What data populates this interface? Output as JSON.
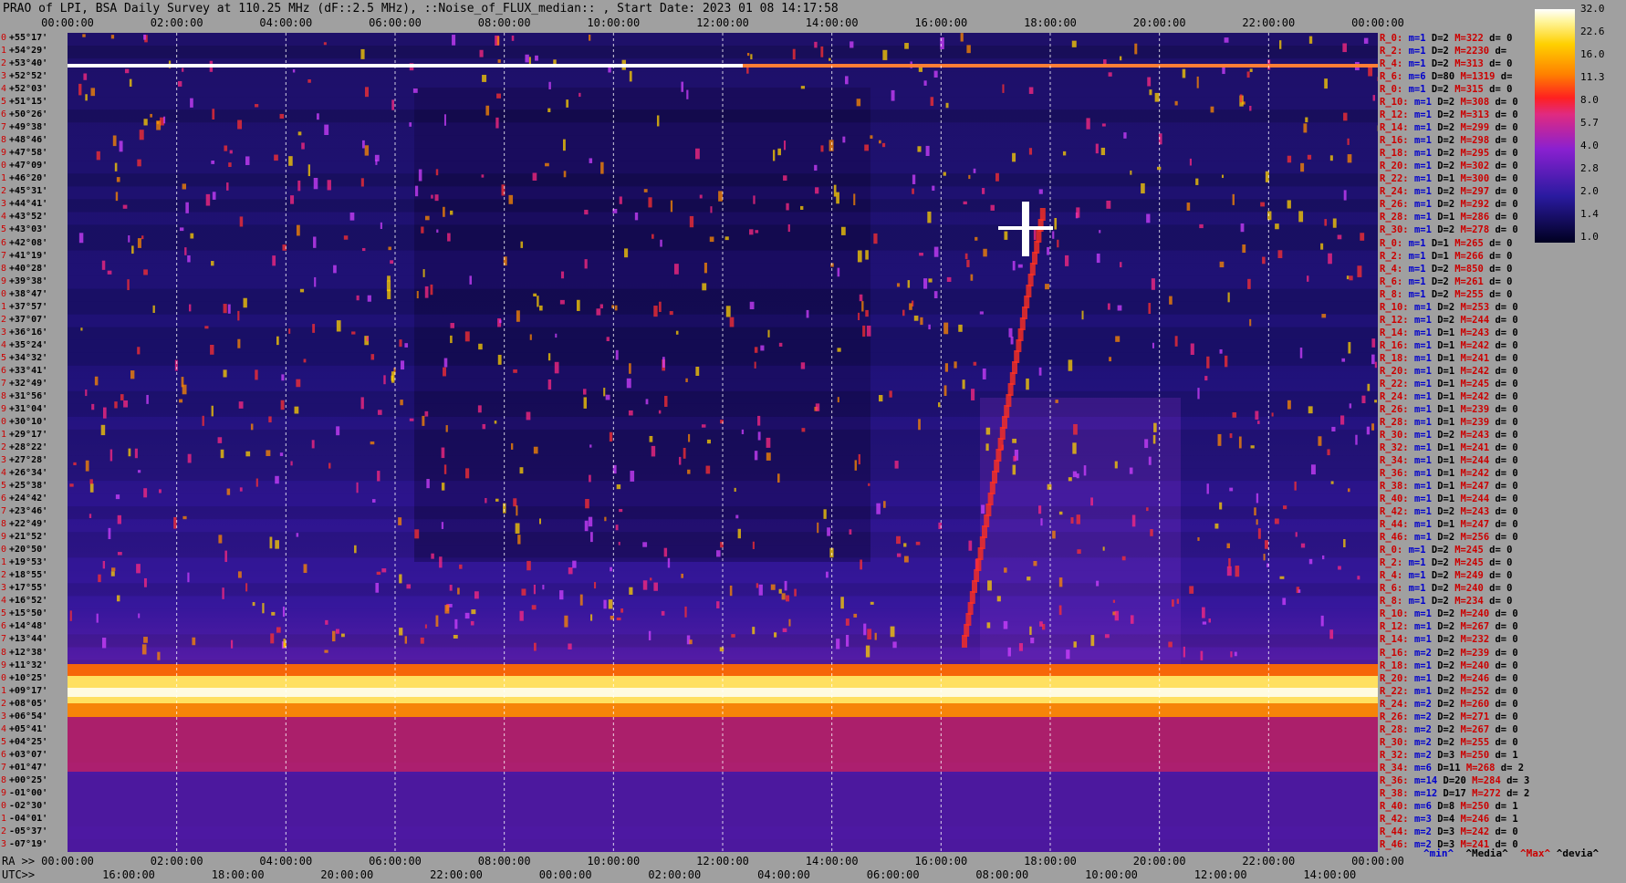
{
  "title": "PRAO of LPI, BSA Daily Survey at 110.25 MHz (dF::2.5 MHz), ::Noise_of_FLUX_median:: , Start Date: 2023 01 08 14:17:58",
  "top_axis_ticks": [
    "00:00:00",
    "02:00:00",
    "04:00:00",
    "06:00:00",
    "08:00:00",
    "10:00:00",
    "12:00:00",
    "14:00:00",
    "16:00:00",
    "18:00:00",
    "20:00:00",
    "22:00:00",
    "00:00:00"
  ],
  "ra_axis": {
    "prefix": "RA >>",
    "ticks": [
      "00:00:00",
      "02:00:00",
      "04:00:00",
      "06:00:00",
      "08:00:00",
      "10:00:00",
      "12:00:00",
      "14:00:00",
      "16:00:00",
      "18:00:00",
      "20:00:00",
      "22:00:00",
      "00:00:00"
    ]
  },
  "utc_axis": {
    "prefix": "UTC>>",
    "ticks": [
      "16:00:00",
      "18:00:00",
      "20:00:00",
      "22:00:00",
      "00:00:00",
      "02:00:00",
      "04:00:00",
      "06:00:00",
      "08:00:00",
      "10:00:00",
      "12:00:00",
      "14:00:00"
    ]
  },
  "declinations": [
    "+55°17'",
    "+54°29'",
    "+53°40'",
    "+52°52'",
    "+52°03'",
    "+51°15'",
    "+50°26'",
    "+49°38'",
    "+48°46'",
    "+47°58'",
    "+47°09'",
    "+46°20'",
    "+45°31'",
    "+44°41'",
    "+43°52'",
    "+43°03'",
    "+42°08'",
    "+41°19'",
    "+40°28'",
    "+39°38'",
    "+38°47'",
    "+37°57'",
    "+37°07'",
    "+36°16'",
    "+35°24'",
    "+34°32'",
    "+33°41'",
    "+32°49'",
    "+31°56'",
    "+31°04'",
    "+30°10'",
    "+29°17'",
    "+28°22'",
    "+27°28'",
    "+26°34'",
    "+25°38'",
    "+24°42'",
    "+23°46'",
    "+22°49'",
    "+21°52'",
    "+20°50'",
    "+19°53'",
    "+18°55'",
    "+17°55'",
    "+16°52'",
    "+15°50'",
    "+14°48'",
    "+13°44'",
    "+12°38'",
    "+11°32'",
    "+10°25'",
    "+09°17'",
    "+08°05'",
    "+06°54'",
    "+05°41'",
    "+04°25'",
    "+03°07'",
    "+01°47'",
    "+00°25'",
    "-01°00'",
    "-02°30'",
    "-04°01'",
    "-05°37'",
    "-07°19'"
  ],
  "stats": [
    {
      "r": "R_0:",
      "m": "m=1",
      "d": "D=2",
      "M": "M=322",
      "dv": "d= 0"
    },
    {
      "r": "R_2:",
      "m": "m=1",
      "d": "D=2",
      "M": "M=2230",
      "dv": "d="
    },
    {
      "r": "R_4:",
      "m": "m=1",
      "d": "D=2",
      "M": "M=313",
      "dv": "d= 0"
    },
    {
      "r": "R_6:",
      "m": "m=6",
      "d": "D=80",
      "M": "M=1319",
      "dv": "d="
    },
    {
      "r": "R_0:",
      "m": "m=1",
      "d": "D=2",
      "M": "M=315",
      "dv": "d= 0"
    },
    {
      "r": "R_10:",
      "m": "m=1",
      "d": "D=2",
      "M": "M=308",
      "dv": "d= 0"
    },
    {
      "r": "R_12:",
      "m": "m=1",
      "d": "D=2",
      "M": "M=313",
      "dv": "d= 0"
    },
    {
      "r": "R_14:",
      "m": "m=1",
      "d": "D=2",
      "M": "M=299",
      "dv": "d= 0"
    },
    {
      "r": "R_16:",
      "m": "m=1",
      "d": "D=2",
      "M": "M=298",
      "dv": "d= 0"
    },
    {
      "r": "R_18:",
      "m": "m=1",
      "d": "D=2",
      "M": "M=295",
      "dv": "d= 0"
    },
    {
      "r": "R_20:",
      "m": "m=1",
      "d": "D=2",
      "M": "M=302",
      "dv": "d= 0"
    },
    {
      "r": "R_22:",
      "m": "m=1",
      "d": "D=1",
      "M": "M=300",
      "dv": "d= 0"
    },
    {
      "r": "R_24:",
      "m": "m=1",
      "d": "D=2",
      "M": "M=297",
      "dv": "d= 0"
    },
    {
      "r": "R_26:",
      "m": "m=1",
      "d": "D=2",
      "M": "M=292",
      "dv": "d= 0"
    },
    {
      "r": "R_28:",
      "m": "m=1",
      "d": "D=1",
      "M": "M=286",
      "dv": "d= 0"
    },
    {
      "r": "R_30:",
      "m": "m=1",
      "d": "D=2",
      "M": "M=278",
      "dv": "d= 0"
    },
    {
      "r": "R_0:",
      "m": "m=1",
      "d": "D=1",
      "M": "M=265",
      "dv": "d= 0"
    },
    {
      "r": "R_2:",
      "m": "m=1",
      "d": "D=1",
      "M": "M=266",
      "dv": "d= 0"
    },
    {
      "r": "R_4:",
      "m": "m=1",
      "d": "D=2",
      "M": "M=850",
      "dv": "d= 0"
    },
    {
      "r": "R_6:",
      "m": "m=1",
      "d": "D=2",
      "M": "M=261",
      "dv": "d= 0"
    },
    {
      "r": "R_8:",
      "m": "m=1",
      "d": "D=2",
      "M": "M=255",
      "dv": "d= 0"
    },
    {
      "r": "R_10:",
      "m": "m=1",
      "d": "D=2",
      "M": "M=253",
      "dv": "d= 0"
    },
    {
      "r": "R_12:",
      "m": "m=1",
      "d": "D=2",
      "M": "M=244",
      "dv": "d= 0"
    },
    {
      "r": "R_14:",
      "m": "m=1",
      "d": "D=1",
      "M": "M=243",
      "dv": "d= 0"
    },
    {
      "r": "R_16:",
      "m": "m=1",
      "d": "D=1",
      "M": "M=242",
      "dv": "d= 0"
    },
    {
      "r": "R_18:",
      "m": "m=1",
      "d": "D=1",
      "M": "M=241",
      "dv": "d= 0"
    },
    {
      "r": "R_20:",
      "m": "m=1",
      "d": "D=1",
      "M": "M=242",
      "dv": "d= 0"
    },
    {
      "r": "R_22:",
      "m": "m=1",
      "d": "D=1",
      "M": "M=245",
      "dv": "d= 0"
    },
    {
      "r": "R_24:",
      "m": "m=1",
      "d": "D=1",
      "M": "M=242",
      "dv": "d= 0"
    },
    {
      "r": "R_26:",
      "m": "m=1",
      "d": "D=1",
      "M": "M=239",
      "dv": "d= 0"
    },
    {
      "r": "R_28:",
      "m": "m=1",
      "d": "D=1",
      "M": "M=239",
      "dv": "d= 0"
    },
    {
      "r": "R_30:",
      "m": "m=1",
      "d": "D=2",
      "M": "M=243",
      "dv": "d= 0"
    },
    {
      "r": "R_32:",
      "m": "m=1",
      "d": "D=1",
      "M": "M=241",
      "dv": "d= 0"
    },
    {
      "r": "R_34:",
      "m": "m=1",
      "d": "D=1",
      "M": "M=244",
      "dv": "d= 0"
    },
    {
      "r": "R_36:",
      "m": "m=1",
      "d": "D=1",
      "M": "M=242",
      "dv": "d= 0"
    },
    {
      "r": "R_38:",
      "m": "m=1",
      "d": "D=1",
      "M": "M=247",
      "dv": "d= 0"
    },
    {
      "r": "R_40:",
      "m": "m=1",
      "d": "D=1",
      "M": "M=244",
      "dv": "d= 0"
    },
    {
      "r": "R_42:",
      "m": "m=1",
      "d": "D=2",
      "M": "M=243",
      "dv": "d= 0"
    },
    {
      "r": "R_44:",
      "m": "m=1",
      "d": "D=1",
      "M": "M=247",
      "dv": "d= 0"
    },
    {
      "r": "R_46:",
      "m": "m=1",
      "d": "D=2",
      "M": "M=256",
      "dv": "d= 0"
    },
    {
      "r": "R_0:",
      "m": "m=1",
      "d": "D=2",
      "M": "M=245",
      "dv": "d= 0"
    },
    {
      "r": "R_2:",
      "m": "m=1",
      "d": "D=2",
      "M": "M=245",
      "dv": "d= 0"
    },
    {
      "r": "R_4:",
      "m": "m=1",
      "d": "D=2",
      "M": "M=249",
      "dv": "d= 0"
    },
    {
      "r": "R_6:",
      "m": "m=1",
      "d": "D=2",
      "M": "M=240",
      "dv": "d= 0"
    },
    {
      "r": "R_8:",
      "m": "m=1",
      "d": "D=2",
      "M": "M=234",
      "dv": "d= 0"
    },
    {
      "r": "R_10:",
      "m": "m=1",
      "d": "D=2",
      "M": "M=240",
      "dv": "d= 0"
    },
    {
      "r": "R_12:",
      "m": "m=1",
      "d": "D=2",
      "M": "M=267",
      "dv": "d= 0"
    },
    {
      "r": "R_14:",
      "m": "m=1",
      "d": "D=2",
      "M": "M=232",
      "dv": "d= 0"
    },
    {
      "r": "R_16:",
      "m": "m=2",
      "d": "D=2",
      "M": "M=239",
      "dv": "d= 0"
    },
    {
      "r": "R_18:",
      "m": "m=1",
      "d": "D=2",
      "M": "M=240",
      "dv": "d= 0"
    },
    {
      "r": "R_20:",
      "m": "m=1",
      "d": "D=2",
      "M": "M=246",
      "dv": "d= 0"
    },
    {
      "r": "R_22:",
      "m": "m=1",
      "d": "D=2",
      "M": "M=252",
      "dv": "d= 0"
    },
    {
      "r": "R_24:",
      "m": "m=2",
      "d": "D=2",
      "M": "M=260",
      "dv": "d= 0"
    },
    {
      "r": "R_26:",
      "m": "m=2",
      "d": "D=2",
      "M": "M=271",
      "dv": "d= 0"
    },
    {
      "r": "R_28:",
      "m": "m=2",
      "d": "D=2",
      "M": "M=267",
      "dv": "d= 0"
    },
    {
      "r": "R_30:",
      "m": "m=2",
      "d": "D=2",
      "M": "M=255",
      "dv": "d= 0"
    },
    {
      "r": "R_32:",
      "m": "m=2",
      "d": "D=3",
      "M": "M=250",
      "dv": "d= 1"
    },
    {
      "r": "R_34:",
      "m": "m=6",
      "d": "D=11",
      "M": "M=268",
      "dv": "d= 2"
    },
    {
      "r": "R_36:",
      "m": "m=14",
      "d": "D=20",
      "M": "M=284",
      "dv": "d= 3"
    },
    {
      "r": "R_38:",
      "m": "m=12",
      "d": "D=17",
      "M": "M=272",
      "dv": "d= 2"
    },
    {
      "r": "R_40:",
      "m": "m=6",
      "d": "D=8",
      "M": "M=250",
      "dv": "d= 1"
    },
    {
      "r": "R_42:",
      "m": "m=3",
      "d": "D=4",
      "M": "M=246",
      "dv": "d= 1"
    },
    {
      "r": "R_44:",
      "m": "m=2",
      "d": "D=3",
      "M": "M=242",
      "dv": "d= 0"
    },
    {
      "r": "R_46:",
      "m": "m=2",
      "d": "D=3",
      "M": "M=241",
      "dv": "d= 0"
    }
  ],
  "stat_legend": {
    "min": "^min^",
    "median": "^Media^",
    "max": "^Max^",
    "devia": "^devia^"
  },
  "colorbar": {
    "labels": [
      "32.0",
      "22.6",
      "16.0",
      "11.3",
      "8.0",
      "5.7",
      "4.0",
      "2.8",
      "2.0",
      "1.4",
      "1.0"
    ]
  },
  "chart_data": {
    "type": "heatmap",
    "title": "PRAO of LPI, BSA Daily Survey at 110.25 MHz (dF::2.5 MHz), ::Noise_of_FLUX_median:: , Start Date: 2023 01 08 14:17:58",
    "x_axis_ra": [
      "00:00:00",
      "02:00:00",
      "04:00:00",
      "06:00:00",
      "08:00:00",
      "10:00:00",
      "12:00:00",
      "14:00:00",
      "16:00:00",
      "18:00:00",
      "20:00:00",
      "22:00:00",
      "00:00:00"
    ],
    "x_axis_utc": [
      "16:00:00",
      "18:00:00",
      "20:00:00",
      "22:00:00",
      "00:00:00",
      "02:00:00",
      "04:00:00",
      "06:00:00",
      "08:00:00",
      "10:00:00",
      "12:00:00",
      "14:00:00"
    ],
    "y_axis": "declination",
    "color_scale": [
      "1.0",
      "1.4",
      "2.0",
      "2.8",
      "4.0",
      "5.7",
      "8.0",
      "11.3",
      "16.0",
      "22.6",
      "32.0"
    ]
  }
}
